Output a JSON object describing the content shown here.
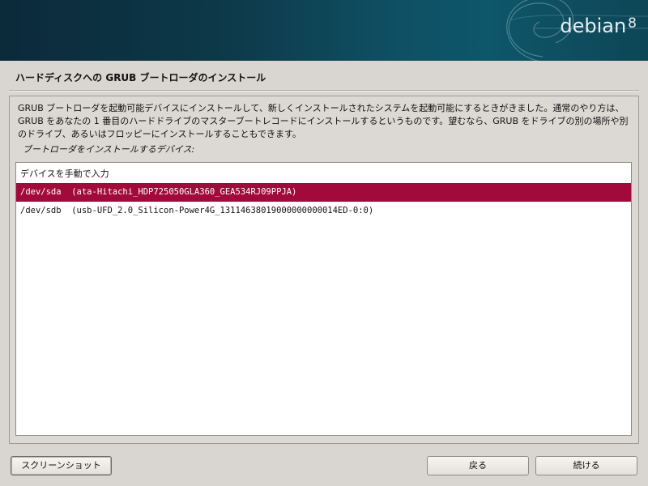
{
  "banner": {
    "brand": "debian",
    "version": "8"
  },
  "page": {
    "title": "ハードディスクへの GRUB ブートローダのインストール",
    "description": "GRUB ブートローダを起動可能デバイスにインストールして、新しくインストールされたシステムを起動可能にするときがきました。通常のやり方は、GRUB をあなたの 1 番目のハードドライブのマスターブートレコードにインストールするというものです。望むなら、GRUB をドライブの別の場所や別のドライブ、あるいはフロッピーにインストールすることもできます。",
    "prompt": "ブートローダをインストールするデバイス:"
  },
  "device_list": {
    "items": [
      "デバイスを手動で入力",
      "/dev/sda  (ata-Hitachi_HDP725050GLA360_GEA534RJ09PPJA)",
      "/dev/sdb  (usb-UFD_2.0_Silicon-Power4G_13114638019000000000014ED-0:0)"
    ],
    "selected_index": 1
  },
  "buttons": {
    "screenshot": "スクリーンショット",
    "back": "戻る",
    "continue": "続ける"
  },
  "colors": {
    "selection": "#a10a3a",
    "banner": "#0d3949"
  }
}
